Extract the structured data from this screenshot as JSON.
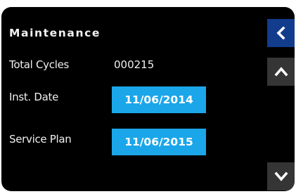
{
  "screen": {
    "title": "Maintenance"
  },
  "rows": {
    "total_cycles": {
      "label": "Total Cycles",
      "value": "000215"
    },
    "inst_date": {
      "label": "Inst. Date",
      "value": "11/06/2014"
    },
    "service_plan": {
      "label": "Service Plan",
      "value": "11/06/2015"
    }
  },
  "nav": {
    "back_icon": "chevron-left-icon",
    "up_icon": "chevron-up-icon",
    "down_icon": "chevron-down-icon"
  },
  "colors": {
    "screen_background": "#000000",
    "value_box": "#1ba6ea",
    "back_button": "#123c8c",
    "scroll_button": "#353535",
    "text": "#f0f0f0"
  }
}
